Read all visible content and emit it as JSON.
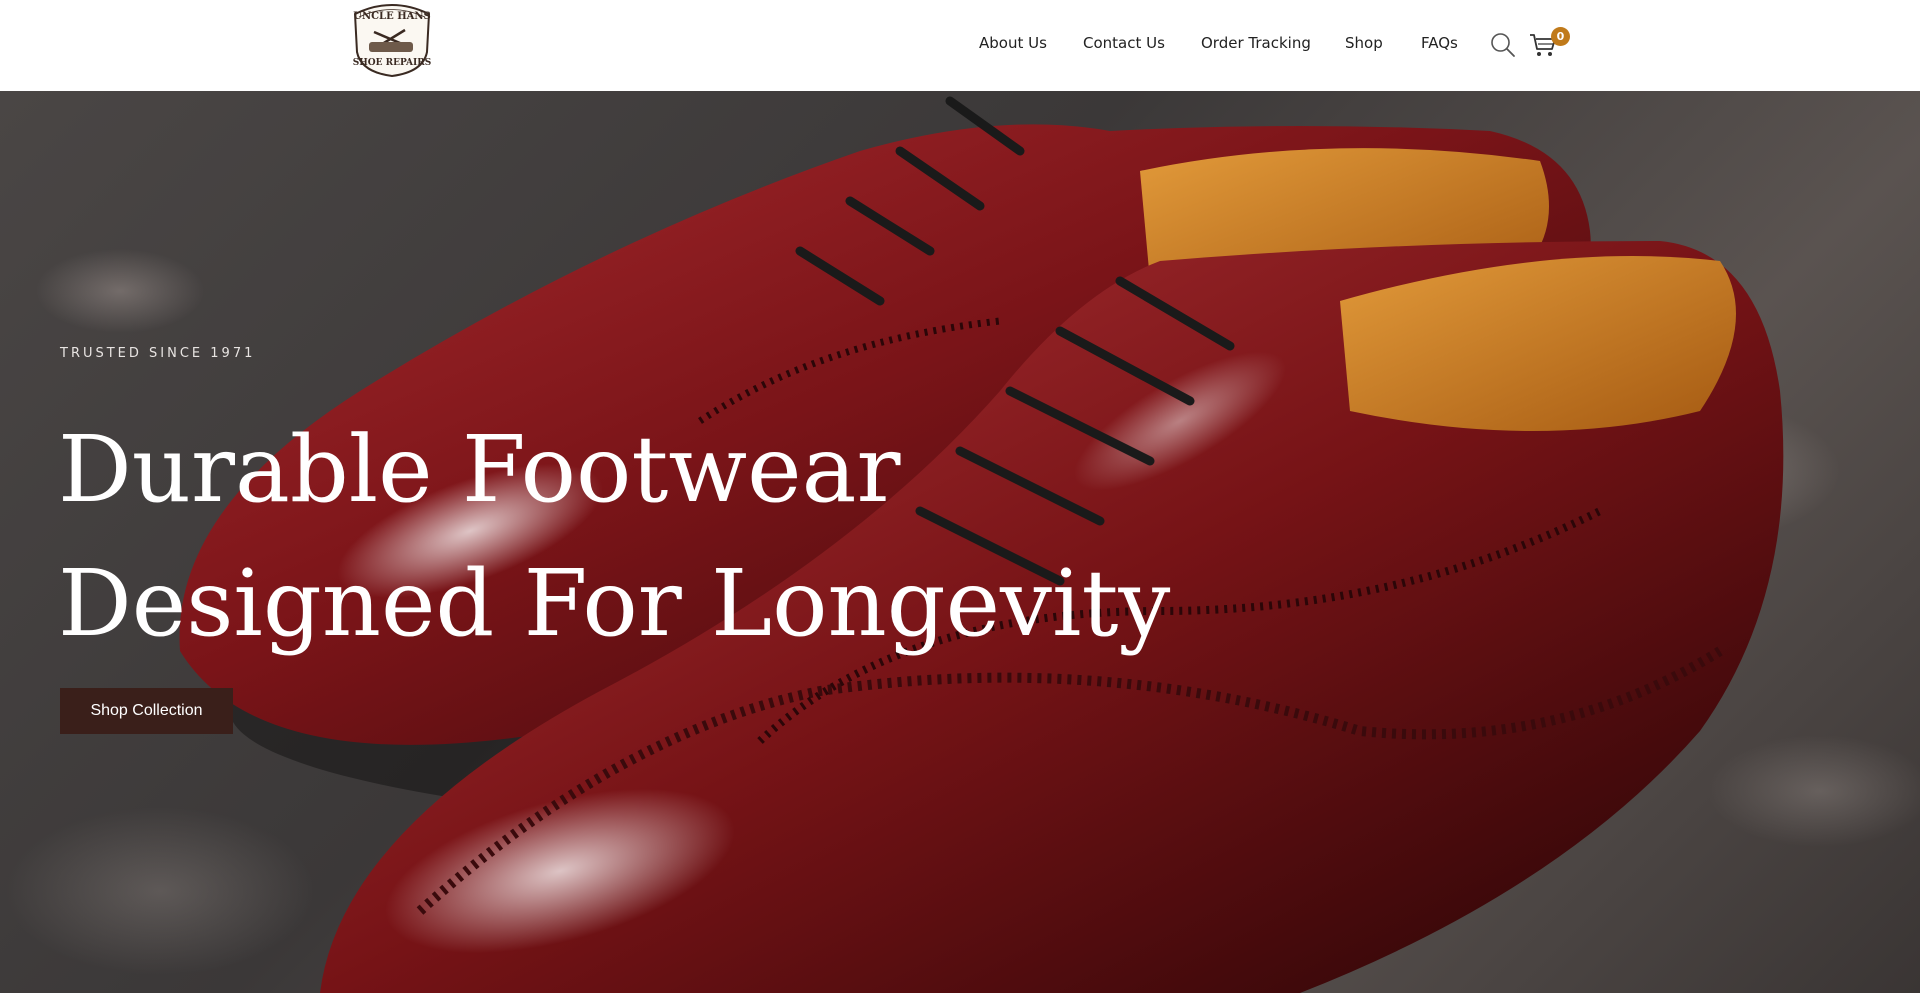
{
  "brand": {
    "logo_text_top": "UNCLE HANS",
    "logo_text_bottom": "SHOE REPAIRS",
    "logo_color": "#3a2a22"
  },
  "nav": {
    "items": [
      {
        "label": "About Us"
      },
      {
        "label": "Contact Us"
      },
      {
        "label": "Order Tracking"
      },
      {
        "label": "Shop"
      },
      {
        "label": "FAQs"
      }
    ],
    "search_icon": "search-icon",
    "cart_icon": "cart-icon",
    "cart_count": "0",
    "badge_color": "#c07a1a"
  },
  "hero": {
    "eyebrow": "TRUSTED SINCE 1971",
    "headline_line1": "Durable Footwear",
    "headline_line2": "Designed For Longevity",
    "cta_label": "Shop Collection",
    "cta_color": "#3a1f1a",
    "shoe_color": "#7a1418",
    "lining_color": "#c8771e"
  }
}
